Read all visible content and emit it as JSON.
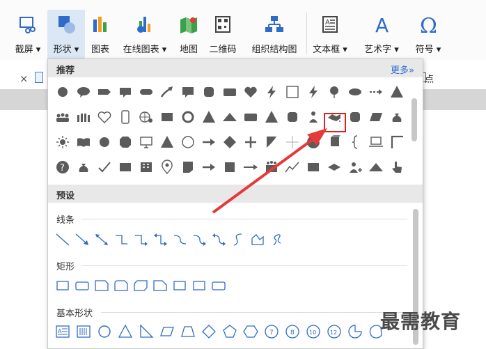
{
  "ribbon": {
    "buttons": [
      {
        "id": "screenshot",
        "label": "截屏 ▾",
        "icon": "screenshot-icon"
      },
      {
        "id": "shapes",
        "label": "形状 ▾",
        "icon": "shapes-icon",
        "active": true
      },
      {
        "id": "chart",
        "label": "图表",
        "icon": "bar-chart-icon"
      },
      {
        "id": "online-chart",
        "label": "在线图表 ▾",
        "icon": "online-chart-icon"
      },
      {
        "id": "map",
        "label": "地图",
        "icon": "map-icon"
      },
      {
        "id": "qrcode",
        "label": "二维码",
        "icon": "qrcode-icon"
      },
      {
        "id": "orgchart",
        "label": "组织结构图",
        "icon": "org-chart-icon"
      },
      {
        "id": "textbox",
        "label": "文本框 ▾",
        "icon": "textbox-icon"
      },
      {
        "id": "wordart",
        "label": "艺术字 ▾",
        "icon": "wordart-icon"
      },
      {
        "id": "symbol",
        "label": "符号 ▾",
        "icon": "omega-icon"
      }
    ]
  },
  "tabbar": {
    "close": "×",
    "right_text": "点"
  },
  "dropdown": {
    "recommended_title": "推荐",
    "more_label": "更多»",
    "preset_title": "预设",
    "lines_title": "线条",
    "rect_title": "矩形",
    "basic_title": "基本形状",
    "recommended_icons": [
      [
        "circle",
        "speech-bubble",
        "arrow-block",
        "callout",
        "rounded-bar",
        "curved-arrow",
        "speech-bubble-square",
        "rounded-square",
        "rounded-rect",
        "heart",
        "lightning",
        "square-outline",
        "lightning",
        "balloon",
        "ellipse",
        "dashed-arrow",
        "triangle"
      ],
      [
        "people-crowd",
        "people-group",
        "heart-outline",
        "phone",
        "globe-gear",
        "rect",
        "ring",
        "triangle",
        "triangle-flat",
        "rounded-rect",
        "triangle",
        "rounded-square",
        "person",
        "handshake",
        "rounded-square",
        "parallelogram",
        "money-bag"
      ],
      [
        "sun",
        "book",
        "circle",
        "octagon",
        "monitor",
        "triangle",
        "circle-outline",
        "arrow-right",
        "diamond",
        "plus",
        "flag",
        "cross-thin",
        "pie",
        "cube",
        "bracket",
        "laptop",
        "corner"
      ],
      [
        "question",
        "money-bag",
        "checkmark",
        "rect",
        "office-people",
        "location-pin",
        "note",
        "arrow-right",
        "square",
        "long-arrow",
        "people-up",
        "line-chart",
        "rect",
        "diamond-flat",
        "person-add",
        "triangle-flat",
        "hand-pointer"
      ]
    ],
    "line_icons": [
      "line",
      "arrow-line",
      "double-arrow-line",
      "elbow",
      "elbow-arrow",
      "elbow-double-arrow",
      "curve",
      "curve-arrow",
      "curve-double-arrow",
      "s-curve",
      "freeform",
      "scribble"
    ],
    "rect_icons": [
      "rect",
      "rounded-rect",
      "snip-rect",
      "snip-rounded",
      "snip-diagonal",
      "snip-one",
      "rect",
      "rect",
      "rounded-rect"
    ],
    "basic_icons": [
      "textbox",
      "vertical-textbox",
      "circle-outline",
      "triangle-outline",
      "right-triangle",
      "parallelogram",
      "trapezoid",
      "diamond",
      "pentagon",
      "hexagon",
      "heptagon-7",
      "octagon-8",
      "decagon-10",
      "dodecagon-12",
      "pie-outline",
      "chord"
    ]
  },
  "watermark": "最需教育",
  "colors": {
    "accent": "#2f6bc9",
    "highlight": "#e02020",
    "icon": "#5b5b5b",
    "active_bg": "#dbe7f5"
  }
}
